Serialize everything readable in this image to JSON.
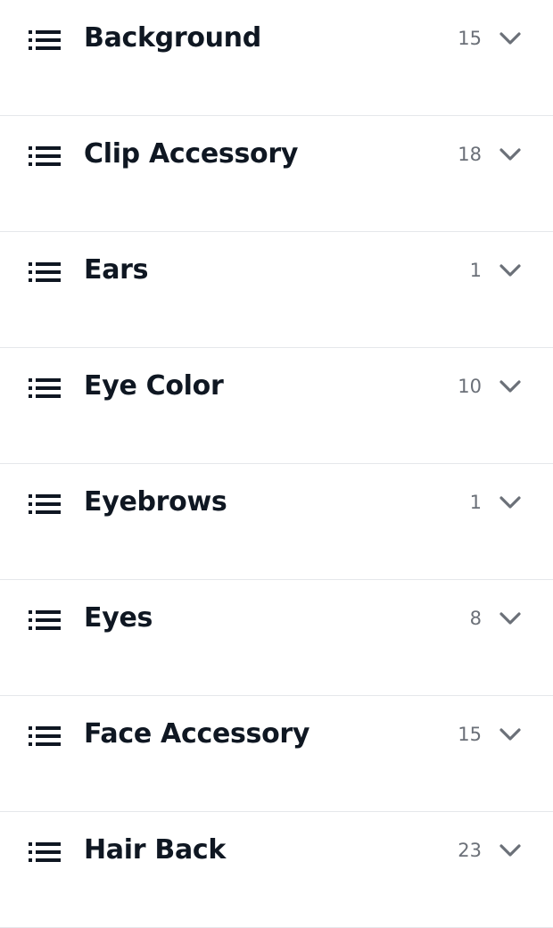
{
  "traits": [
    {
      "label": "Background",
      "count": "15",
      "icon": "list-icon",
      "toggle_icon": "chevron-down-icon"
    },
    {
      "label": "Clip Accessory",
      "count": "18",
      "icon": "list-icon",
      "toggle_icon": "chevron-down-icon"
    },
    {
      "label": "Ears",
      "count": "1",
      "icon": "list-icon",
      "toggle_icon": "chevron-down-icon"
    },
    {
      "label": "Eye Color",
      "count": "10",
      "icon": "list-icon",
      "toggle_icon": "chevron-down-icon"
    },
    {
      "label": "Eyebrows",
      "count": "1",
      "icon": "list-icon",
      "toggle_icon": "chevron-down-icon"
    },
    {
      "label": "Eyes",
      "count": "8",
      "icon": "list-icon",
      "toggle_icon": "chevron-down-icon"
    },
    {
      "label": "Face Accessory",
      "count": "15",
      "icon": "list-icon",
      "toggle_icon": "chevron-down-icon"
    },
    {
      "label": "Hair Back",
      "count": "23",
      "icon": "list-icon",
      "toggle_icon": "chevron-down-icon"
    }
  ],
  "colors": {
    "title": "#0f1722",
    "count": "#6b7078",
    "divider": "#e5e7eb",
    "chevron": "#6b7078"
  }
}
